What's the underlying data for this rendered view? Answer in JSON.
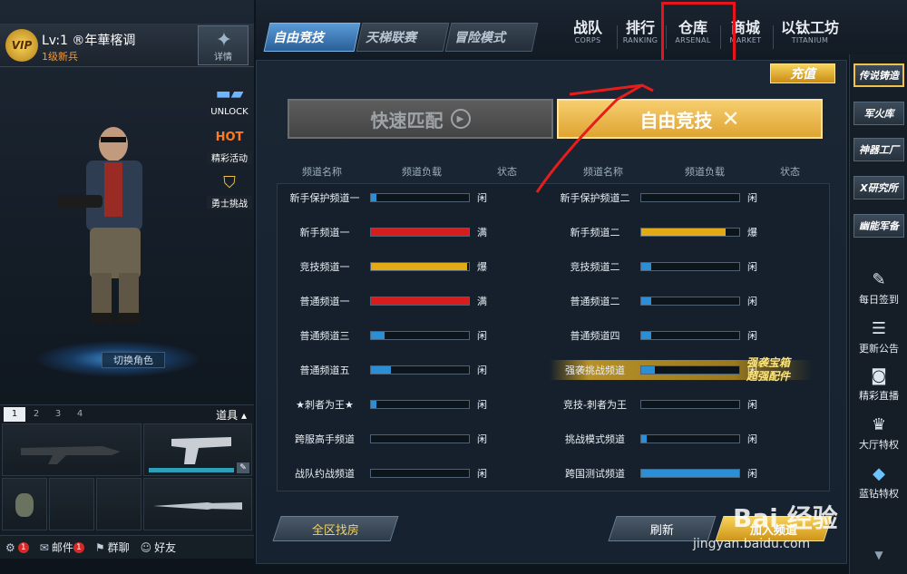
{
  "player": {
    "vip": "VIP",
    "name": "Lv:1 ®年華楁调",
    "rank": "1级新兵",
    "detail_label": "详情",
    "switch_role": "切换角色"
  },
  "side_promos": [
    {
      "label": "UNLOCK",
      "icon": "rifle-lock-icon"
    },
    {
      "label": "精彩活动",
      "icon": "hot-icon"
    },
    {
      "label": "勇士挑战",
      "icon": "shield-wings-icon"
    }
  ],
  "weapon_panel": {
    "tabs": [
      "1",
      "2",
      "3",
      "4"
    ],
    "props_label": "道具"
  },
  "bottom_bar": {
    "settings_badge": "1",
    "mail": "邮件",
    "mail_badge": "1",
    "group_chat": "群聊",
    "friends": "好友"
  },
  "mode_tabs": [
    "自由竞技",
    "天梯联赛",
    "冒险模式"
  ],
  "nav": [
    {
      "cn": "战队",
      "en": "CORPS"
    },
    {
      "cn": "排行",
      "en": "RANKING"
    },
    {
      "cn": "仓库",
      "en": "ARSENAL"
    },
    {
      "cn": "商城",
      "en": "MARKET"
    },
    {
      "cn": "以钛工坊",
      "en": "TITANIUM"
    }
  ],
  "recharge": "充值",
  "quick_match": "快速匹配",
  "free_battle": "自由竞技",
  "column_headers": {
    "name": "频道名称",
    "load": "频道负载",
    "status": "状态"
  },
  "channels_left": [
    {
      "name": "新手保护频道一",
      "load": 0.06,
      "status": "闲",
      "color": "#2a8fd6"
    },
    {
      "name": "新手频道一",
      "load": 1.0,
      "status": "满",
      "color": "#d61c1c"
    },
    {
      "name": "竞技频道一",
      "load": 0.98,
      "status": "爆",
      "color": "#e2aa17"
    },
    {
      "name": "普通频道一",
      "load": 1.0,
      "status": "满",
      "color": "#d61c1c"
    },
    {
      "name": "普通频道三",
      "load": 0.14,
      "status": "闲",
      "color": "#2a8fd6"
    },
    {
      "name": "普通频道五",
      "load": 0.2,
      "status": "闲",
      "color": "#2a8fd6"
    },
    {
      "name": "★刺者为王★",
      "load": 0.06,
      "status": "闲",
      "color": "#2a8fd6"
    },
    {
      "name": "跨服高手频道",
      "load": 0.0,
      "status": "闲",
      "color": "#2a8fd6"
    },
    {
      "name": "战队约战频道",
      "load": 0.0,
      "status": "闲",
      "color": "#2a8fd6"
    }
  ],
  "channels_right": [
    {
      "name": "新手保护频道二",
      "load": 0.0,
      "status": "闲",
      "color": "#2a8fd6"
    },
    {
      "name": "新手频道二",
      "load": 0.86,
      "status": "爆",
      "color": "#e2aa17"
    },
    {
      "name": "竞技频道二",
      "load": 0.1,
      "status": "闲",
      "color": "#2a8fd6"
    },
    {
      "name": "普通频道二",
      "load": 0.1,
      "status": "闲",
      "color": "#2a8fd6"
    },
    {
      "name": "普通频道四",
      "load": 0.1,
      "status": "闲",
      "color": "#2a8fd6"
    },
    {
      "name": "强袭挑战频道",
      "load": 0.14,
      "status": "闲",
      "color": "#2a8fd6",
      "promo": true
    },
    {
      "name": "竞技-刺者为王",
      "load": 0.0,
      "status": "闲",
      "color": "#2a8fd6"
    },
    {
      "name": "挑战模式频道",
      "load": 0.06,
      "status": "闲",
      "color": "#2a8fd6"
    },
    {
      "name": "跨国测试频道",
      "load": 1.0,
      "status": "闲",
      "color": "#2a8fd6"
    }
  ],
  "promo_text": [
    "强袭宝箱",
    "超强配件"
  ],
  "buttons": {
    "zone_rooms": "全区找房",
    "refresh": "刷新",
    "join_channel": "加入频道"
  },
  "right_top": [
    "传说铸造",
    "军火库",
    "神器工厂",
    "X研究所",
    "幽能军备"
  ],
  "right_icons": [
    {
      "label": "每日签到",
      "icon": "calendar-edit-icon"
    },
    {
      "label": "更新公告",
      "icon": "announcement-icon"
    },
    {
      "label": "精彩直播",
      "icon": "camera-icon"
    },
    {
      "label": "大厅特权",
      "icon": "trophy-icon"
    },
    {
      "label": "蓝钻特权",
      "icon": "diamond-icon"
    }
  ],
  "watermark": {
    "main": "Bai 经验",
    "sub": "jingyan.baidu.com"
  }
}
